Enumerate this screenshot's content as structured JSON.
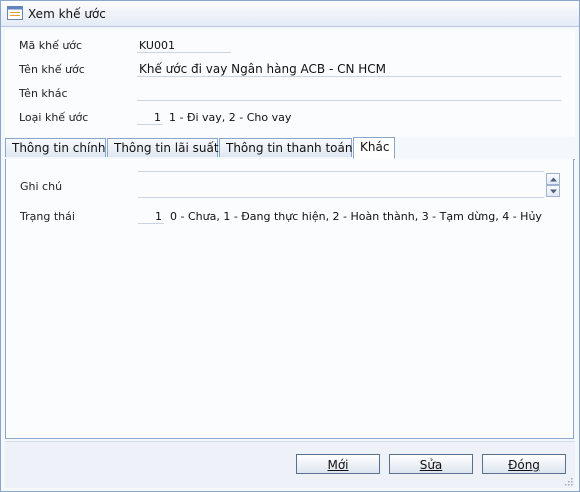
{
  "window": {
    "title": "Xem khế ước"
  },
  "form": {
    "code_label": "Mã khế ước",
    "code_value": "KU001",
    "name_label": "Tên khế ước",
    "name_value": "Khế ước đi vay Ngân hàng ACB - CN HCM",
    "other_name_label": "Tên khác",
    "other_name_value": "",
    "type_label": "Loại khế ước",
    "type_value": "1",
    "type_hint": "1 - Đi vay, 2 - Cho vay"
  },
  "tabs": [
    {
      "label": "Thông tin chính"
    },
    {
      "label": "Thông tin lãi suất"
    },
    {
      "label": "Thông tin thanh toán"
    },
    {
      "label": "Khác"
    }
  ],
  "other_tab": {
    "note_label": "Ghi chú",
    "note_value": "",
    "status_label": "Trạng thái",
    "status_value": "1",
    "status_hint": "0 - Chưa, 1 - Đang thực hiện, 2 - Hoàn thành, 3 - Tạm dừng, 4 - Hủy"
  },
  "footer": {
    "new_label": "Mới",
    "edit_label": "Sửa",
    "close_label": "Đóng"
  }
}
